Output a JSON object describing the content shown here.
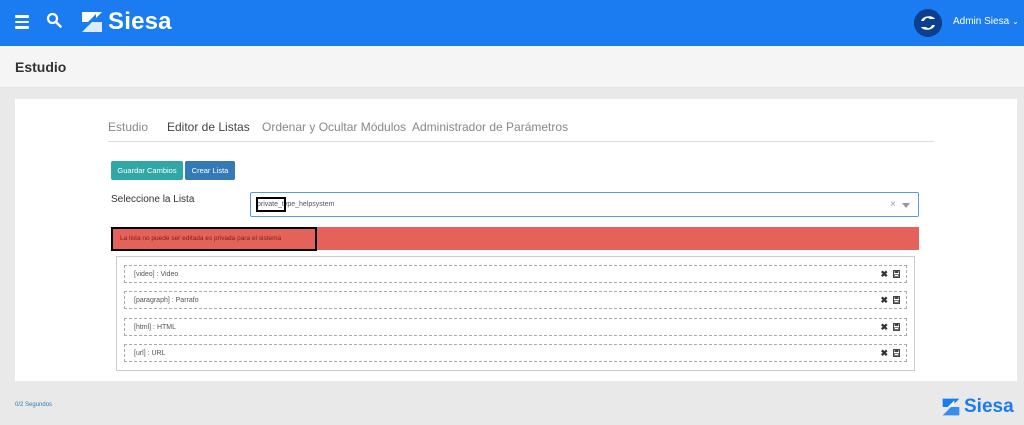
{
  "header": {
    "brand": "Siesa",
    "user": "Admin Siesa",
    "bar_color": "#1a7cf0"
  },
  "page": {
    "title": "Estudio"
  },
  "tabs": [
    {
      "label": "Estudio",
      "active": false
    },
    {
      "label": "Editor de Listas",
      "active": true
    },
    {
      "label": "Ordenar y Ocultar Módulos",
      "active": false
    },
    {
      "label": "Administrador de Parámetros",
      "active": false
    }
  ],
  "toolbar": {
    "save_label": "Guardar Cambios",
    "create_label": "Crear Lista"
  },
  "select": {
    "label": "Seleccione la Lista",
    "value": "private_type_helpsystem",
    "clear": "×"
  },
  "alert": {
    "text": "La lista no puede ser editada es privada para el sistema",
    "color": "#e5625a"
  },
  "list": {
    "items": [
      {
        "label": "[video] : Video"
      },
      {
        "label": "[paragraph] : Parrafo"
      },
      {
        "label": "[html] : HTML"
      },
      {
        "label": "[url] : URL"
      }
    ],
    "delete_glyph": "✖"
  },
  "footer": {
    "time": "0/2 Segundos",
    "brand": "Siesa"
  }
}
